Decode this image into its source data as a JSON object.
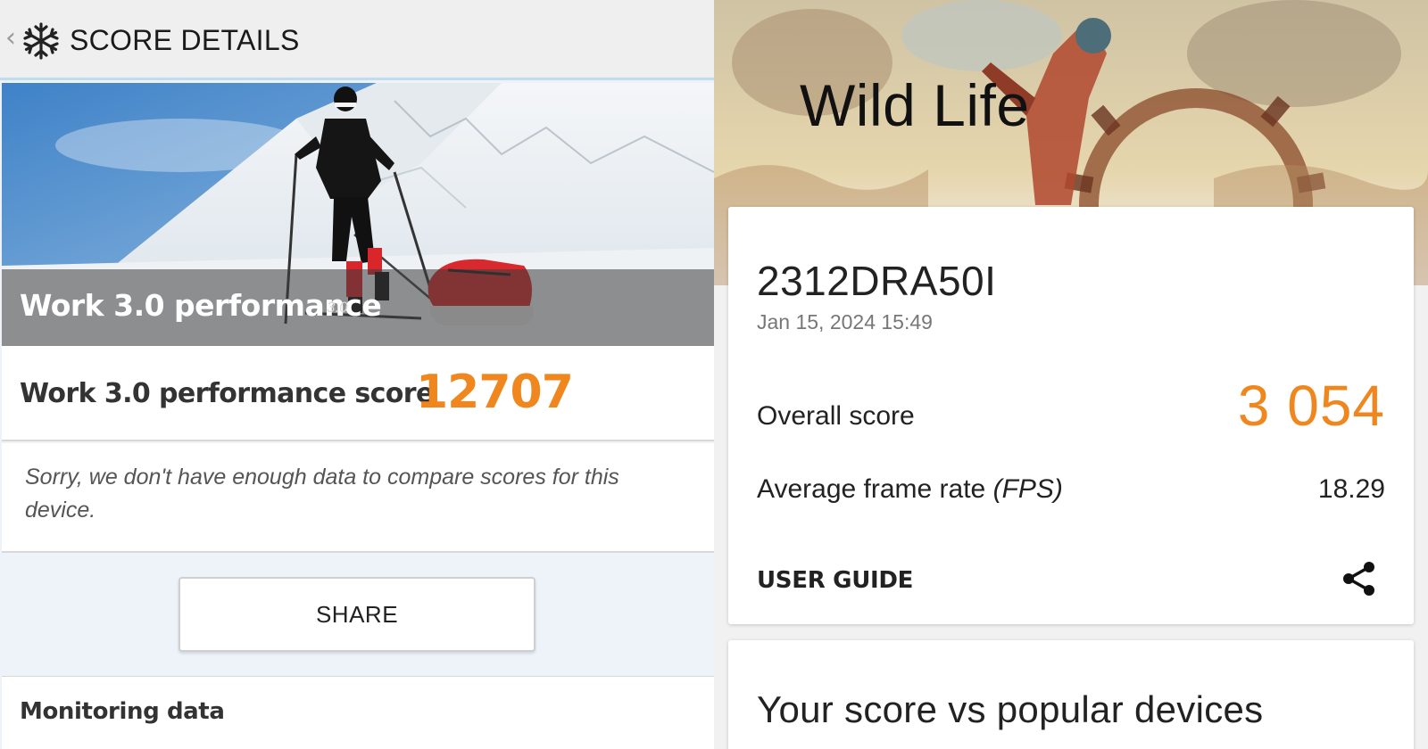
{
  "left_app": {
    "header": {
      "back_glyph": "‹",
      "logo_icon": "snowflake-logo-icon",
      "title": "SCORE DETAILS"
    },
    "hero": {
      "title": "Work 3.0 performance",
      "version": "3.0"
    },
    "score": {
      "label": "Work 3.0 performance score",
      "value": "12707"
    },
    "note": "Sorry, we don't have enough data to compare scores for this device.",
    "share_label": "SHARE",
    "monitoring_label": "Monitoring data",
    "colors": {
      "accent": "#f0861e",
      "header_bg": "#efefef",
      "page_bg": "#eef3f9"
    }
  },
  "right_app": {
    "banner_title": "Wild Life",
    "result": {
      "device": "2312DRA50I",
      "date": "Jan 15, 2024 15:49",
      "overall_label": "Overall score",
      "overall_value": "3 054",
      "fps_label": "Average frame rate ",
      "fps_unit": "(FPS)",
      "fps_value": "18.29",
      "user_guide": "USER GUIDE",
      "share_icon": "share-icon"
    },
    "compare_title": "Your score vs popular devices",
    "colors": {
      "accent": "#f0861e",
      "card_bg": "#ffffff",
      "page_bg": "#f1f1f1"
    }
  }
}
